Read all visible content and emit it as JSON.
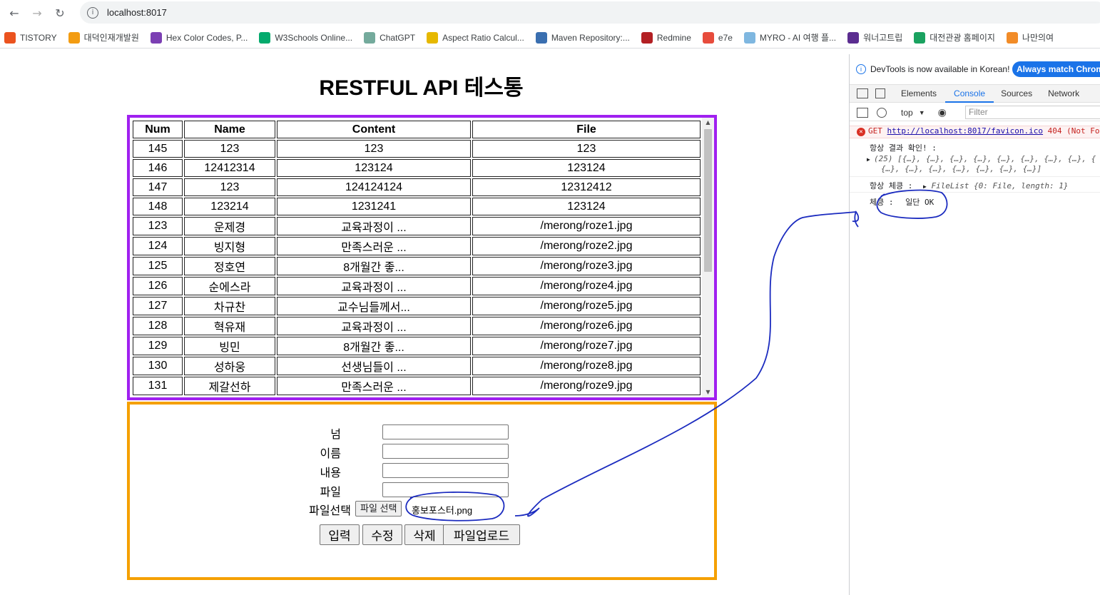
{
  "browser": {
    "url": "localhost:8017",
    "bookmarks": [
      {
        "label": "TISTORY",
        "color": "#eb531f"
      },
      {
        "label": "대덕인재개발원",
        "color": "#f39c12"
      },
      {
        "label": "Hex Color Codes, P...",
        "color": "#7b3fb3"
      },
      {
        "label": "W3Schools Online...",
        "color": "#04aa6d"
      },
      {
        "label": "ChatGPT",
        "color": "#74aa9c"
      },
      {
        "label": "Aspect Ratio Calcul...",
        "color": "#e6b800"
      },
      {
        "label": "Maven Repository:...",
        "color": "#3a6fb0"
      },
      {
        "label": "Redmine",
        "color": "#b32024"
      },
      {
        "label": "e7e",
        "color": "#e74c3c"
      },
      {
        "label": "MYRO - AI 여행 플...",
        "color": "#7fb7e0"
      },
      {
        "label": "워너고트립",
        "color": "#5b2d90"
      },
      {
        "label": "대전관광 홈페이지",
        "color": "#1aa260"
      },
      {
        "label": "나만의여",
        "color": "#f28c28"
      }
    ]
  },
  "page": {
    "title": "RESTFUL API 테스통",
    "table": {
      "headers": [
        "Num",
        "Name",
        "Content",
        "File"
      ],
      "rows": [
        [
          "145",
          "123",
          "123",
          "123"
        ],
        [
          "146",
          "12412314",
          "123124",
          "123124"
        ],
        [
          "147",
          "123",
          "124124124",
          "12312412"
        ],
        [
          "148",
          "123214",
          "1231241",
          "123124"
        ],
        [
          "123",
          "운제경",
          "교육과정이 ...",
          "/merong/roze1.jpg"
        ],
        [
          "124",
          "빙지형",
          "만족스러운 ...",
          "/merong/roze2.jpg"
        ],
        [
          "125",
          "정호연",
          "8개월간 좋...",
          "/merong/roze3.jpg"
        ],
        [
          "126",
          "순에스라",
          "교육과정이 ...",
          "/merong/roze4.jpg"
        ],
        [
          "127",
          "차규찬",
          "교수님들께서...",
          "/merong/roze5.jpg"
        ],
        [
          "128",
          "혁유재",
          "교육과정이 ...",
          "/merong/roze6.jpg"
        ],
        [
          "129",
          "빙민",
          "8개월간 좋...",
          "/merong/roze7.jpg"
        ],
        [
          "130",
          "성하웅",
          "선생님들이 ...",
          "/merong/roze8.jpg"
        ],
        [
          "131",
          "제갈선하",
          "만족스러운 ...",
          "/merong/roze9.jpg"
        ]
      ]
    },
    "form": {
      "num_label": "넘",
      "name_label": "이름",
      "content_label": "내용",
      "file_label": "파일",
      "file_select_label": "파일선택",
      "file_choose_button": "파일 선택",
      "chosen_file": "홍보포스터.png",
      "buttons": {
        "insert": "입력",
        "update": "수정",
        "delete": "삭제",
        "upload": "파일업로드"
      }
    }
  },
  "devtools": {
    "notice": "DevTools is now available in Korean!",
    "notice_button": "Always match Chrome",
    "tabs": [
      "Elements",
      "Console",
      "Sources",
      "Network"
    ],
    "active_tab": "Console",
    "context": "top",
    "filter_placeholder": "Filter",
    "error": {
      "method": "GET",
      "url": "http://localhost:8017/favicon.ico",
      "status": "404 (Not Fo"
    },
    "logs": [
      {
        "label": "항상 결과 확인! :",
        "value": ""
      },
      {
        "label": "(25) [{…}, {…}, {…}, {…}, {…}, {…}, {…}, {…}, {",
        "value": ""
      },
      {
        "label": "{…}, {…}, {…}, {…}, {…}, {…}, {…}]",
        "value": ""
      },
      {
        "label": "항상 체킁 :",
        "value": "FileList {0: File, length: 1}"
      },
      {
        "label": "체킁 :",
        "value": "일단 OK"
      }
    ]
  }
}
